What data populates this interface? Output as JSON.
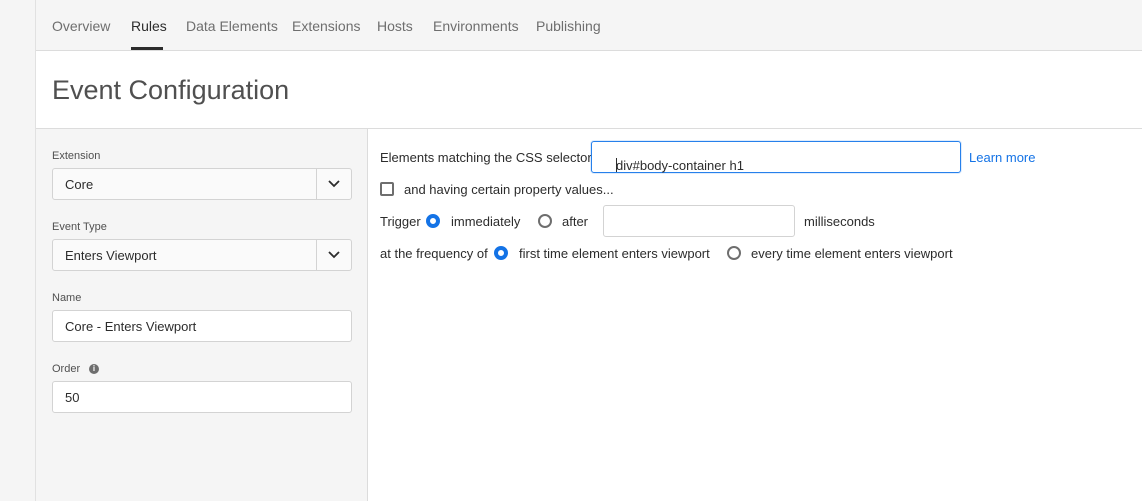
{
  "nav": {
    "tabs": [
      {
        "label": "Overview",
        "active": false
      },
      {
        "label": "Rules",
        "active": true
      },
      {
        "label": "Data Elements",
        "active": false
      },
      {
        "label": "Extensions",
        "active": false
      },
      {
        "label": "Hosts",
        "active": false
      },
      {
        "label": "Environments",
        "active": false
      },
      {
        "label": "Publishing",
        "active": false
      }
    ]
  },
  "page": {
    "title": "Event Configuration"
  },
  "sidebar": {
    "extension": {
      "label": "Extension",
      "value": "Core"
    },
    "event_type": {
      "label": "Event Type",
      "value": "Enters Viewport"
    },
    "name": {
      "label": "Name",
      "value": "Core - Enters Viewport"
    },
    "order": {
      "label": "Order",
      "value": "50"
    }
  },
  "config": {
    "selector_label": "Elements matching the CSS selector",
    "selector_value": "div#body-container h1",
    "learn_more": "Learn more",
    "property_values": {
      "label": "and having certain property values...",
      "checked": false
    },
    "trigger": {
      "label": "Trigger",
      "immediately_label": "immediately",
      "after_label": "after",
      "delay_value": "",
      "units": "milliseconds",
      "selected": "immediately"
    },
    "frequency": {
      "label": "at the frequency of",
      "first_time_label": "first time element enters viewport",
      "every_time_label": "every time element enters viewport",
      "selected": "first_time"
    }
  },
  "colors": {
    "accent": "#1473e6",
    "focus_border": "#2680eb",
    "panel_bg": "#f5f5f5"
  }
}
